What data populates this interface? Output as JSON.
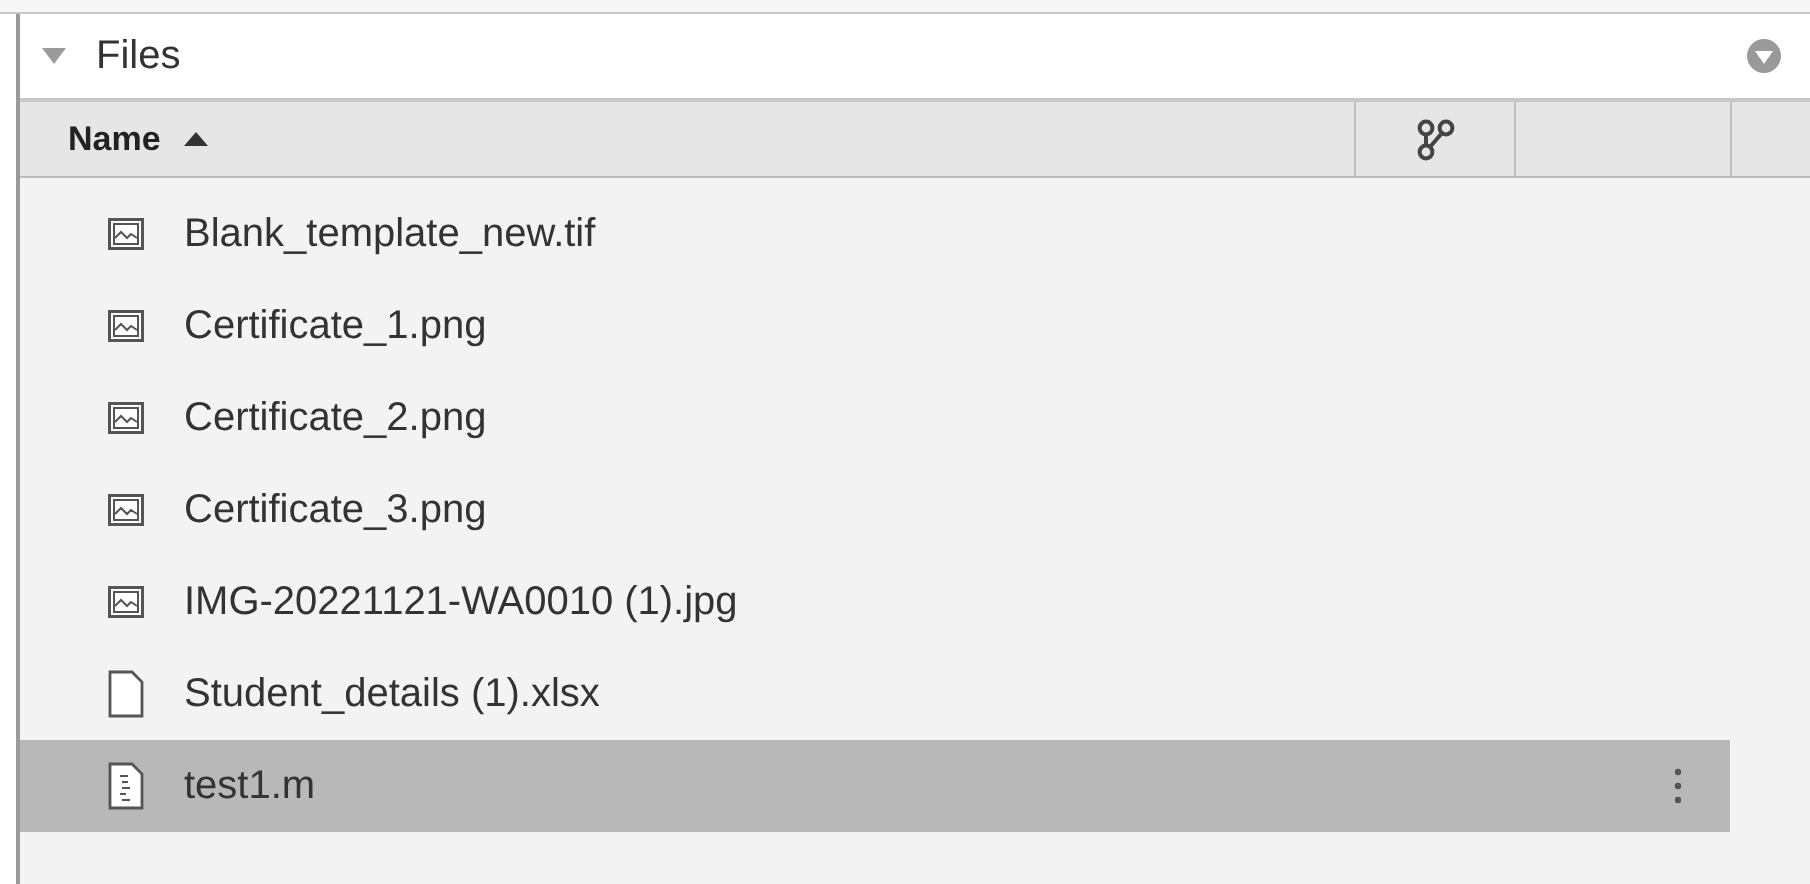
{
  "panel": {
    "title": "Files",
    "expanded": true
  },
  "columns": [
    {
      "label": "Name",
      "sort_ascending": true
    },
    {
      "kind": "source-control"
    },
    {
      "kind": "blank"
    }
  ],
  "files": [
    {
      "name": "Blank_template_new.tif",
      "kind": "image",
      "selected": false
    },
    {
      "name": "Certificate_1.png",
      "kind": "image",
      "selected": false
    },
    {
      "name": "Certificate_2.png",
      "kind": "image",
      "selected": false
    },
    {
      "name": "Certificate_3.png",
      "kind": "image",
      "selected": false
    },
    {
      "name": "IMG-20221121-WA0010 (1).jpg",
      "kind": "image",
      "selected": false
    },
    {
      "name": "Student_details (1).xlsx",
      "kind": "document",
      "selected": false
    },
    {
      "name": "test1.m",
      "kind": "script",
      "selected": true
    }
  ]
}
